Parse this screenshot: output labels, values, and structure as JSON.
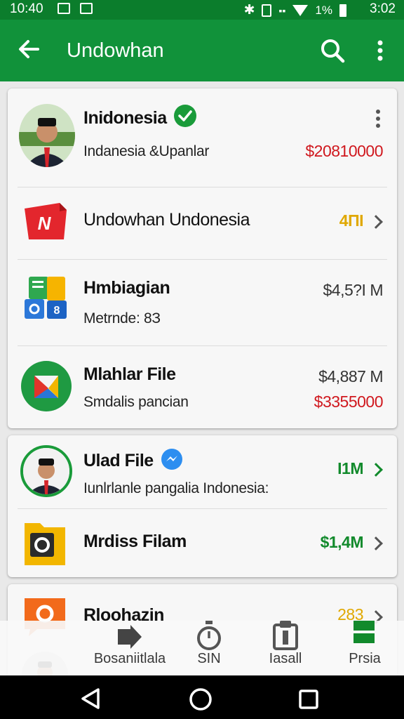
{
  "status_bar": {
    "time_left": "10:40",
    "time_right": "3:02",
    "battery": "1%"
  },
  "app_bar": {
    "title": "Undowhan"
  },
  "card1": {
    "profile": {
      "name": "Inidonesia",
      "subtitle": "Indanesia &Upanlar",
      "value": "$20810000"
    },
    "items": [
      {
        "name": "Undowhan Undonesia",
        "value": "4ПI"
      },
      {
        "name": "Hmbiagian",
        "subtitle": "Metrnde: 8З",
        "value": "$4,5?I M"
      },
      {
        "name": "Mlahlar File",
        "subtitle": "Smdalis pancian",
        "value": "$4,887 M",
        "value2": "$3355000"
      }
    ]
  },
  "card2": {
    "items": [
      {
        "name": "Ulad File",
        "subtitle": "Iunlrlanle pangalia Indonesia:",
        "value": "I1M"
      },
      {
        "name": "Mrdiss Filam",
        "value": "$1,4M"
      }
    ]
  },
  "card3": {
    "items": [
      {
        "name": "Rloohazin",
        "value": "283"
      }
    ]
  },
  "bottom_nav": [
    {
      "label": "Bosaniitlala",
      "icon": "play-icon"
    },
    {
      "label": "SIN",
      "icon": "stopwatch-icon"
    },
    {
      "label": "Iasall",
      "icon": "clipboard-icon"
    },
    {
      "label": "Prsia",
      "icon": "flag-icon"
    }
  ],
  "colors": {
    "primary": "#11923a",
    "status": "#0b7d2c",
    "red": "#d0181e",
    "green": "#128a2c",
    "amber": "#e0a800"
  }
}
